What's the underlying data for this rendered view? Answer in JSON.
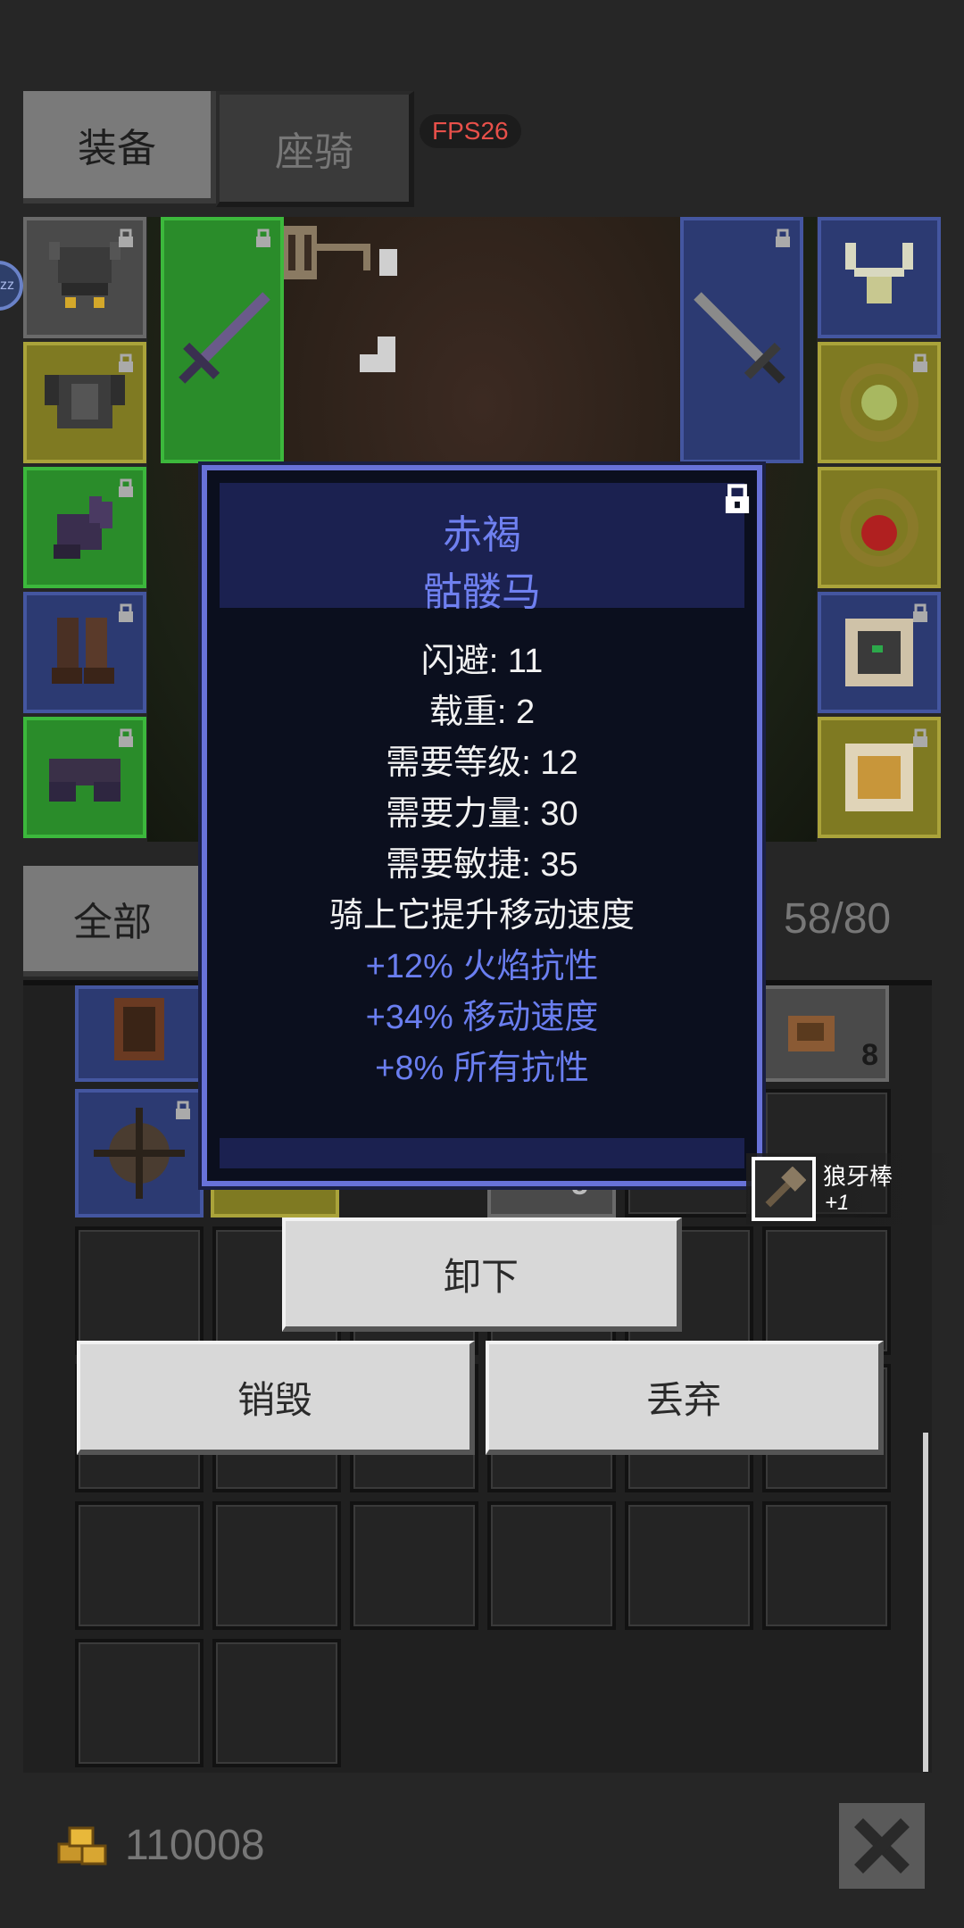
{
  "tabs": {
    "equipment": "装备",
    "mount": "座骑"
  },
  "fps": "FPS26",
  "sleep_badge": "zz",
  "filter": {
    "all_label": "全部",
    "capacity": "58/80"
  },
  "tooltip": {
    "name": "赤褐",
    "type": "骷髅马",
    "stats": [
      "闪避: 11",
      "载重: 2",
      "需要等级: 12",
      "需要力量: 30",
      "需要敏捷: 35",
      "骑上它提升移动速度"
    ],
    "bonuses": [
      "+12% 火焰抗性",
      "+34% 移动速度",
      "+8% 所有抗性"
    ]
  },
  "pickup": {
    "name": "狼牙棒",
    "bonus": "+1"
  },
  "inventory": {
    "stack_count": "8",
    "partial_count": "5"
  },
  "buttons": {
    "unequip": "卸下",
    "destroy": "销毁",
    "drop": "丢弃"
  },
  "gold_amount": "110008",
  "colors": {
    "rarity_blue": "#4456a0",
    "rarity_green": "#3cb83c",
    "rarity_yellow": "#aaa33a",
    "rarity_gray": "#6a6a6a",
    "tooltip_border": "#6872d8",
    "tooltip_title": "#6f80f0",
    "fps_text": "#e8504a"
  },
  "icons": [
    "lock-icon",
    "gold-coins-icon",
    "close-icon",
    "mace-icon",
    "helmet-icon",
    "armor-icon",
    "glove-icon",
    "boots-icon",
    "pants-icon",
    "sword-icon",
    "amulet-icon",
    "ring-icon",
    "scroll-icon"
  ]
}
